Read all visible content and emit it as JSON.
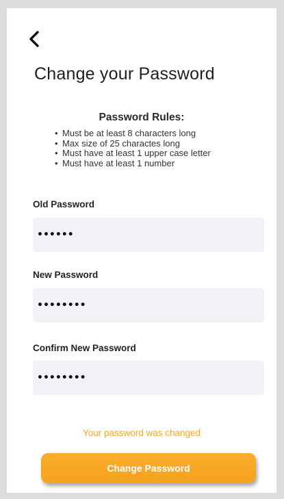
{
  "header": {
    "back_icon": "chevron-left-icon",
    "title": "Change your Password"
  },
  "rules": {
    "heading": "Password Rules:",
    "items": [
      "Must be at least 8 characters long",
      "Max size of 25 charactes long",
      "Must have at least 1 upper case letter",
      "Must have at least 1 number"
    ]
  },
  "form": {
    "old_password": {
      "label": "Old Password",
      "value": "••••••"
    },
    "new_password": {
      "label": "New Password",
      "value": "••••••••"
    },
    "confirm_password": {
      "label": "Confirm New Password",
      "value": "••••••••"
    }
  },
  "status": {
    "message": "Your password was changed"
  },
  "actions": {
    "submit_label": "Change Password"
  },
  "colors": {
    "accent": "#f5a623",
    "input_bg": "#f1f2f8",
    "frame": "#dcdcdc"
  }
}
